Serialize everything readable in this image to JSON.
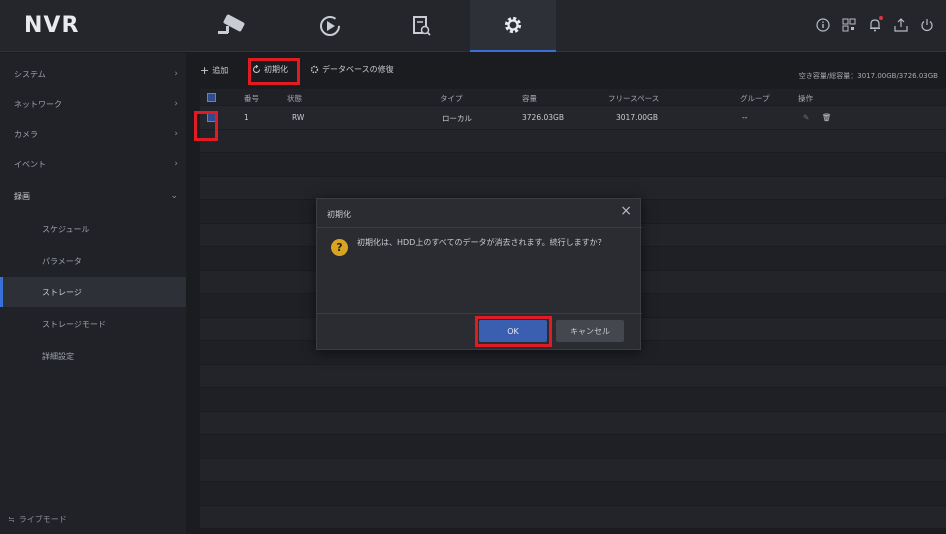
{
  "app": {
    "title": "NVR"
  },
  "nav": {
    "tabs": [
      {
        "icon": "camera-icon"
      },
      {
        "icon": "playback-icon"
      },
      {
        "icon": "search-file-icon"
      },
      {
        "icon": "settings-gear-icon",
        "active": true
      }
    ],
    "right_icons": [
      "info-icon",
      "qr-code-icon",
      "notification-bell-icon",
      "export-icon",
      "power-icon"
    ]
  },
  "sidebar": {
    "items": [
      {
        "label": "システム",
        "chevron": "›"
      },
      {
        "label": "ネットワーク",
        "chevron": "›"
      },
      {
        "label": "カメラ",
        "chevron": "›"
      },
      {
        "label": "イベント",
        "chevron": "›"
      },
      {
        "label": "録画",
        "chevron": "⌄"
      }
    ],
    "subitems": [
      {
        "label": "スケジュール"
      },
      {
        "label": "パラメータ"
      },
      {
        "label": "ストレージ",
        "selected": true
      },
      {
        "label": "ストレージモード"
      },
      {
        "label": "詳細設定"
      }
    ],
    "live_mode": "ライブモード",
    "live_mode_icon": "≒"
  },
  "toolbar": {
    "add_label": "追加",
    "add_icon": "+",
    "init_label": "初期化",
    "db_repair_label": "データベースの修復",
    "capacity_text": "空き容量/総容量：3017.00GB/3726.03GB"
  },
  "table": {
    "headers": [
      "番号",
      "状態",
      "タイプ",
      "容量",
      "フリースペース",
      "グループ",
      "操作"
    ],
    "rows": [
      {
        "number": "1",
        "status": "RW",
        "type": "ローカル",
        "capacity": "3726.03GB",
        "free": "3017.00GB",
        "group": "--",
        "edit_icon": "✎",
        "delete_icon": "🗑"
      }
    ]
  },
  "dialog": {
    "title": "初期化",
    "close": "×",
    "message": "初期化は、HDD上のすべてのデータが消去されます。続行しますか？",
    "ok_label": "OK",
    "cancel_label": "キャンセル"
  },
  "colors": {
    "accent": "#3a6fd8",
    "highlight": "#e01b24",
    "warning": "#d9a41e"
  }
}
